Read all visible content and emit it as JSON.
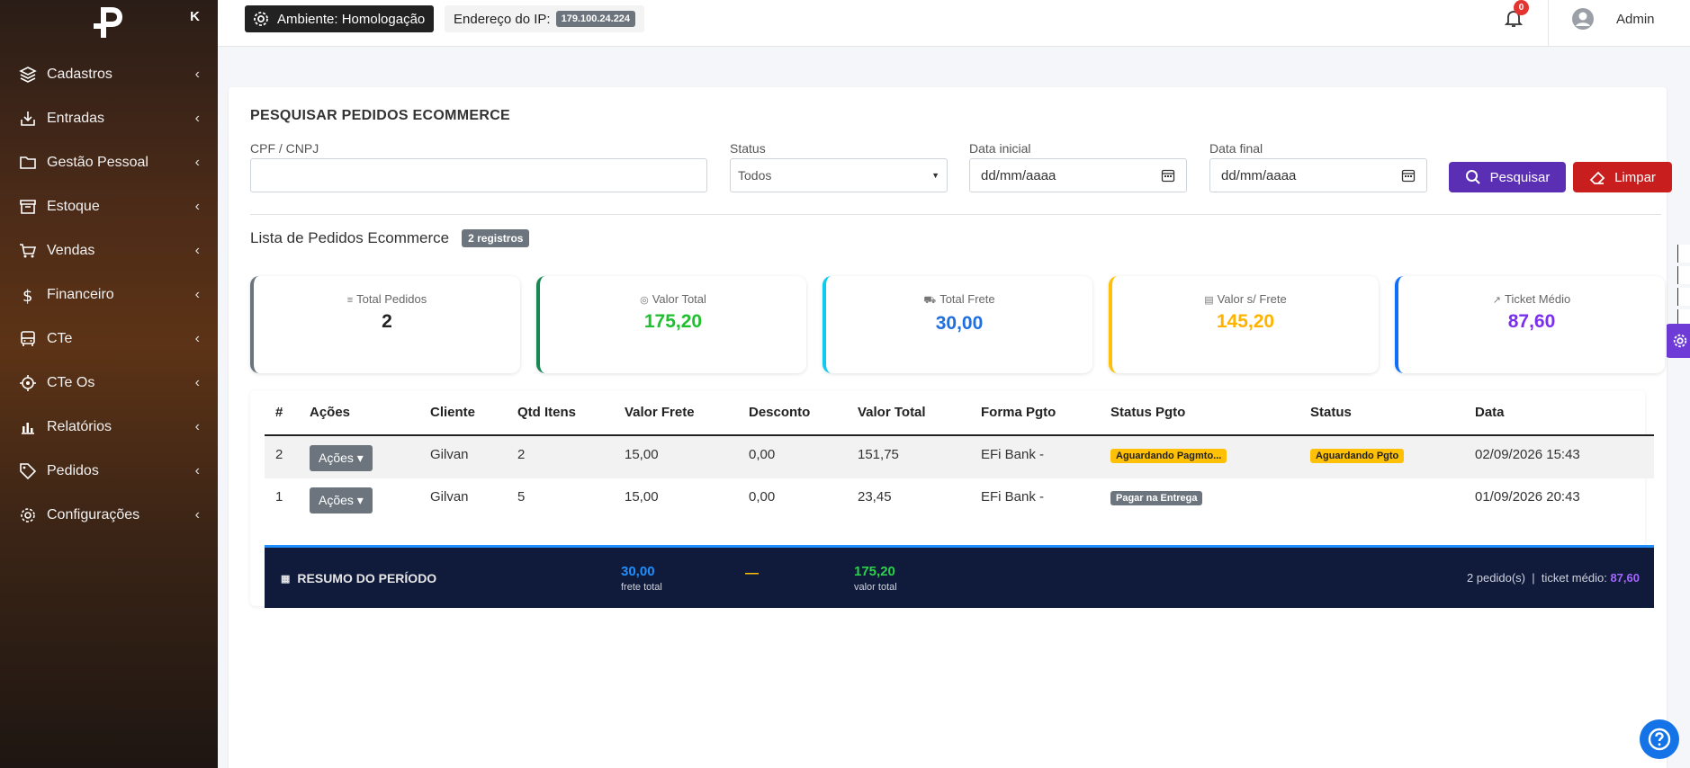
{
  "sidebar": {
    "collapse_symbol": "K",
    "items": [
      {
        "label": "Cadastros",
        "icon": "layers-icon"
      },
      {
        "label": "Entradas",
        "icon": "download-icon"
      },
      {
        "label": "Gestão Pessoal",
        "icon": "folder-icon"
      },
      {
        "label": "Estoque",
        "icon": "archive-icon"
      },
      {
        "label": "Vendas",
        "icon": "cart-icon"
      },
      {
        "label": "Financeiro",
        "icon": "dollar-icon"
      },
      {
        "label": "CTe",
        "icon": "bus-icon"
      },
      {
        "label": "CTe Os",
        "icon": "crosshair-icon"
      },
      {
        "label": "Relatórios",
        "icon": "bar-chart-icon"
      },
      {
        "label": "Pedidos",
        "icon": "tag-icon"
      },
      {
        "label": "Configurações",
        "icon": "gear-icon"
      }
    ],
    "chevron": "‹"
  },
  "header": {
    "environment": "Ambiente: Homologação",
    "ip_label": "Endereço do IP:",
    "ip_value": "179.100.24.224",
    "notification_count": "0",
    "user_name": "Admin"
  },
  "search": {
    "title": "PESQUISAR PEDIDOS ECOMMERCE",
    "cpf_label": "CPF / CNPJ",
    "cpf_value": "",
    "status_label": "Status",
    "status_value": "Todos",
    "start_label": "Data inicial",
    "start_value": "dd/mm/aaaa",
    "end_label": "Data final",
    "end_value": "dd/mm/aaaa",
    "search_button": "Pesquisar",
    "clear_button": "Limpar"
  },
  "list": {
    "title": "Lista de Pedidos Ecommerce",
    "count_badge": "2 registros"
  },
  "stats": [
    {
      "label": "Total Pedidos",
      "value": "2",
      "icon": "≡",
      "color": "#6c757d",
      "value_color": "#222222"
    },
    {
      "label": "Valor Total",
      "value": "175,20",
      "icon": "◎",
      "color": "#198754",
      "value_color": "#1fbf2f"
    },
    {
      "label": "Total Frete",
      "value": "30,00",
      "icon": "⛟",
      "color": "#0dcaf0",
      "value_color": "#1f6fe0"
    },
    {
      "label": "Valor s/ Frete",
      "value": "145,20",
      "icon": "▤",
      "color": "#ffc107",
      "value_color": "#ffb300"
    },
    {
      "label": "Ticket Médio",
      "value": "87,60",
      "icon": "↗",
      "color": "#0d6efd",
      "value_color": "#7a2ff0"
    }
  ],
  "table": {
    "headers": [
      "#",
      "Ações",
      "Cliente",
      "Qtd Itens",
      "Valor Frete",
      "Desconto",
      "Valor Total",
      "Forma Pgto",
      "Status Pgto",
      "Status",
      "Data"
    ],
    "action_label": "Ações",
    "rows": [
      {
        "id": "2",
        "cliente": "Gilvan",
        "qtd": "2",
        "frete": "15,00",
        "desconto": "0,00",
        "total": "151,75",
        "forma": "EFi Bank -",
        "status_pgto": "Aguardando Pagmto...",
        "status": "Aguardando Pgto",
        "data": "02/09/2026 15:43"
      },
      {
        "id": "1",
        "cliente": "Gilvan",
        "qtd": "5",
        "frete": "15,00",
        "desconto": "0,00",
        "total": "23,45",
        "forma": "EFi Bank -",
        "status_pgto": "Pagar na Entrega",
        "status": "",
        "data": "01/09/2026 20:43"
      }
    ]
  },
  "summary": {
    "title": "RESUMO DO PERÍODO",
    "frete_value": "30,00",
    "frete_label": "frete total",
    "desconto_value": "—",
    "total_value": "175,20",
    "total_label": "valor total",
    "orders_text": "2 pedido(s)",
    "separator": "|",
    "ticket_label": "ticket médio:",
    "ticket_value": "87,60"
  }
}
